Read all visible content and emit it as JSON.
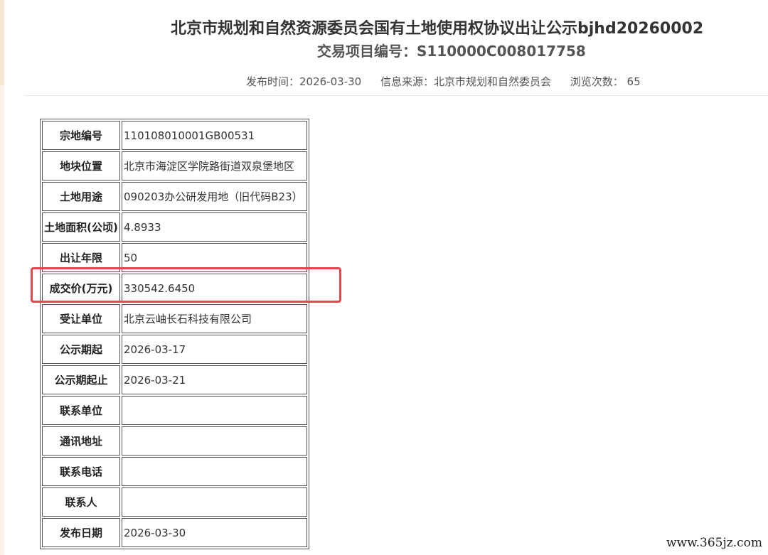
{
  "header": {
    "title": "北京市规划和自然资源委员会国有土地使用权协议出让公示bjhd20260002",
    "project_number": "交易项目编号：S110000C008017758"
  },
  "meta": {
    "publish_time": "发布时间：2026-03-30",
    "source": "信息来源：北京市规划和自然委员会",
    "views": "浏览次数： 65"
  },
  "table": {
    "rows": [
      {
        "label": "宗地编号",
        "value": "110108010001GB00531"
      },
      {
        "label": "地块位置",
        "value": "北京市海淀区学院路街道双泉堡地区"
      },
      {
        "label": "土地用途",
        "value": "090203办公研发用地（旧代码B23）"
      },
      {
        "label": "土地面积(公顷)",
        "value": "4.8933"
      },
      {
        "label": "出让年限",
        "value": "50"
      },
      {
        "label": "成交价(万元)",
        "value": "330542.6450"
      },
      {
        "label": "受让单位",
        "value": "北京云岫长石科技有限公司"
      },
      {
        "label": "公示期起",
        "value": "2026-03-17"
      },
      {
        "label": "公示期起止",
        "value": "2026-03-21"
      },
      {
        "label": "联系单位",
        "value": ""
      },
      {
        "label": "通讯地址",
        "value": ""
      },
      {
        "label": "联系电话",
        "value": ""
      },
      {
        "label": "联系人",
        "value": ""
      },
      {
        "label": "发布日期",
        "value": "2026-03-30"
      }
    ]
  },
  "annotation": {
    "highlight_color": "#e8454a",
    "highlighted_row": "成交价(万元)"
  },
  "watermark": "www.365jz.com"
}
